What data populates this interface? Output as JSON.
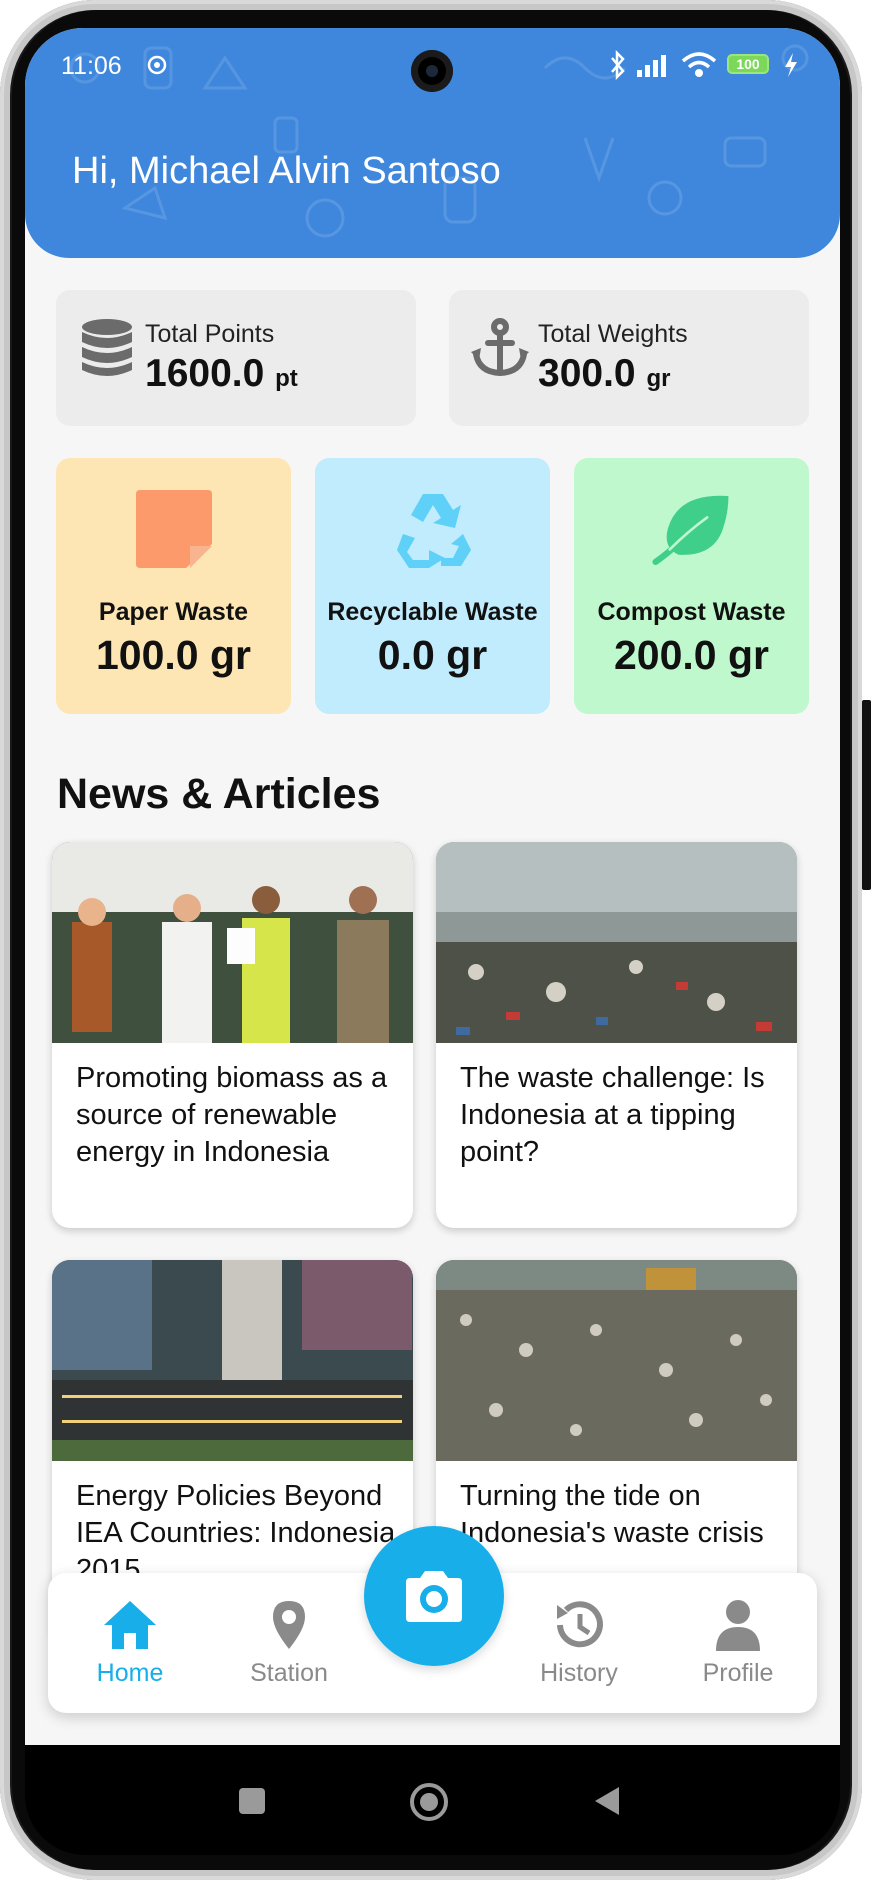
{
  "status_bar": {
    "time": "11:06",
    "battery": "100"
  },
  "header": {
    "greeting": "Hi, Michael Alvin Santoso"
  },
  "stats": [
    {
      "label": "Total Points",
      "value": "1600.0",
      "unit": "pt",
      "icon": "database-icon"
    },
    {
      "label": "Total Weights",
      "value": "300.0",
      "unit": "gr",
      "icon": "anchor-icon"
    }
  ],
  "waste": [
    {
      "label": "Paper Waste",
      "value": "100.0 gr",
      "icon": "paper-note-icon",
      "color": "#fde6b3",
      "icon_color": "#fd9a6b"
    },
    {
      "label": "Recyclable Waste",
      "value": "0.0 gr",
      "icon": "recycle-icon",
      "color": "#c1ecfd",
      "icon_color": "#5fd0f8"
    },
    {
      "label": "Compost Waste",
      "value": "200.0 gr",
      "icon": "leaf-icon",
      "color": "#bff8cc",
      "icon_color": "#3fcf8a"
    }
  ],
  "news": {
    "title": "News & Articles",
    "articles": [
      {
        "title": "Promoting biomass as a source of renewable energy in Indonesia",
        "image": "signing-ceremony-photo"
      },
      {
        "title": "The waste challenge: Is Indonesia at a tipping point?",
        "image": "polluted-sea-photo"
      },
      {
        "title": "Energy Policies Beyond IEA Countries: Indonesia 2015",
        "image": "city-aerial-photo"
      },
      {
        "title": "Turning the tide on Indonesia's waste crisis",
        "image": "river-trash-photo"
      }
    ]
  },
  "nav": {
    "items": [
      {
        "label": "Home",
        "icon": "home-icon",
        "active": true
      },
      {
        "label": "Station",
        "icon": "map-pin-icon",
        "active": false
      },
      {
        "label": "History",
        "icon": "history-icon",
        "active": false
      },
      {
        "label": "Profile",
        "icon": "person-icon",
        "active": false
      }
    ],
    "fab_icon": "camera-icon"
  },
  "colors": {
    "header": "#3f87dc",
    "accent": "#17aeea",
    "inactive": "#8a8a8a"
  }
}
